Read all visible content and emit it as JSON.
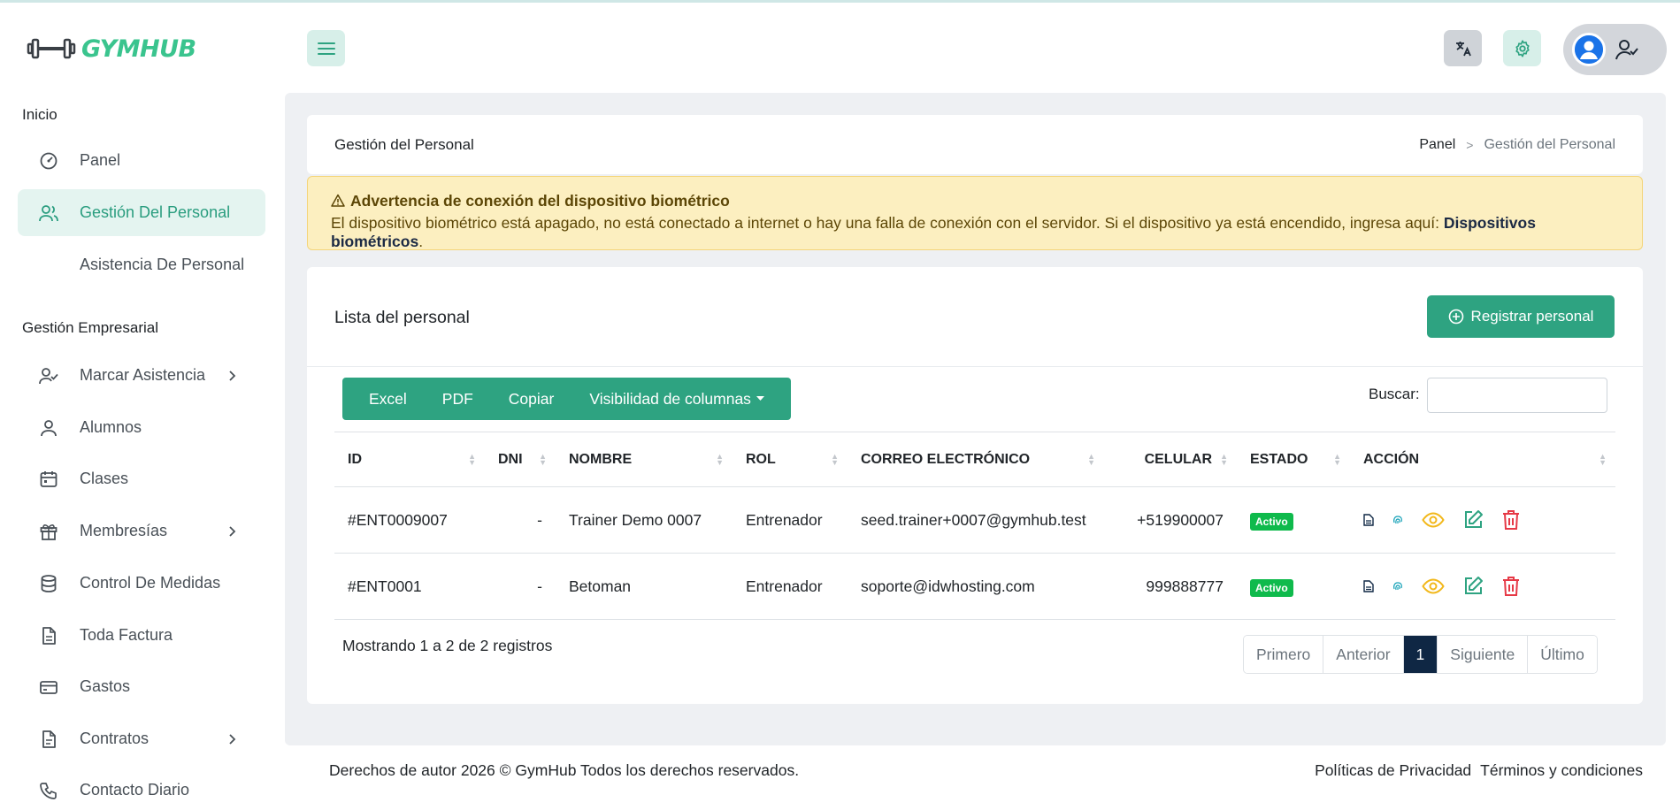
{
  "brand": {
    "name": "GYMHUB",
    "accent": "#3ac48e",
    "primary": "#2ea381"
  },
  "topbar": {
    "menu_icon": "hamburger-icon",
    "translate_icon": "translate-icon",
    "settings_icon": "gear-icon",
    "user_icon": "user-check-icon"
  },
  "sidebar": {
    "sections": [
      {
        "label": "Inicio"
      },
      {
        "label": "Gestión Empresarial"
      }
    ],
    "items": [
      {
        "label": "Panel",
        "icon": "gauge-icon"
      },
      {
        "label": "Gestión Del Personal",
        "icon": "users-icon",
        "active": true
      },
      {
        "label": "Asistencia De Personal",
        "icon": ""
      },
      {
        "label": "Marcar Asistencia",
        "icon": "user-check-icon",
        "has_children": true
      },
      {
        "label": "Alumnos",
        "icon": "user-icon"
      },
      {
        "label": "Clases",
        "icon": "calendar-icon"
      },
      {
        "label": "Membresías",
        "icon": "gift-icon",
        "has_children": true
      },
      {
        "label": "Control De Medidas",
        "icon": "database-icon"
      },
      {
        "label": "Toda Factura",
        "icon": "file-text-icon"
      },
      {
        "label": "Gastos",
        "icon": "credit-card-icon"
      },
      {
        "label": "Contratos",
        "icon": "file-icon",
        "has_children": true
      },
      {
        "label": "Contacto Diario",
        "icon": "phone-icon"
      }
    ]
  },
  "page": {
    "title": "Gestión del Personal",
    "breadcrumb": {
      "home": "Panel",
      "separator": ">",
      "current": "Gestión del Personal"
    }
  },
  "alert": {
    "title": "Advertencia de conexión del dispositivo biométrico",
    "body": "El dispositivo biométrico está apagado, no está conectado a internet o hay una falla de conexión con el servidor. Si el dispositivo ya está encendido, ingresa aquí: ",
    "link": "Dispositivos biométricos",
    "end": "."
  },
  "list": {
    "title": "Lista del personal",
    "register_label": "Registrar personal",
    "export": {
      "excel": "Excel",
      "pdf": "PDF",
      "copy": "Copiar",
      "columns": "Visibilidad de columnas"
    },
    "search_label": "Buscar:",
    "search_value": "",
    "columns": [
      "ID",
      "DNI",
      "NOMBRE",
      "ROL",
      "CORREO ELECTRÓNICO",
      "CELULAR",
      "ESTADO",
      "ACCIÓN"
    ],
    "rows": [
      {
        "id": "#ENT0009007",
        "dni": "-",
        "name": "Trainer Demo 0007",
        "role": "Entrenador",
        "email": "seed.trainer+0007@gymhub.test",
        "phone": "+519900007",
        "status": "Activo"
      },
      {
        "id": "#ENT0001",
        "dni": "-",
        "name": "Betoman",
        "role": "Entrenador",
        "email": "soporte@idwhosting.com",
        "phone": "999888777",
        "status": "Activo"
      }
    ],
    "showing": "Mostrando 1 a 2 de 2 registros",
    "pagination": {
      "first": "Primero",
      "prev": "Anterior",
      "current": "1",
      "next": "Siguiente",
      "last": "Último"
    }
  },
  "footer": {
    "copyright": "Derechos de autor 2026 © GymHub Todos los derechos reservados.",
    "privacy": "Políticas de Privacidad",
    "terms": "Términos y condiciones"
  }
}
